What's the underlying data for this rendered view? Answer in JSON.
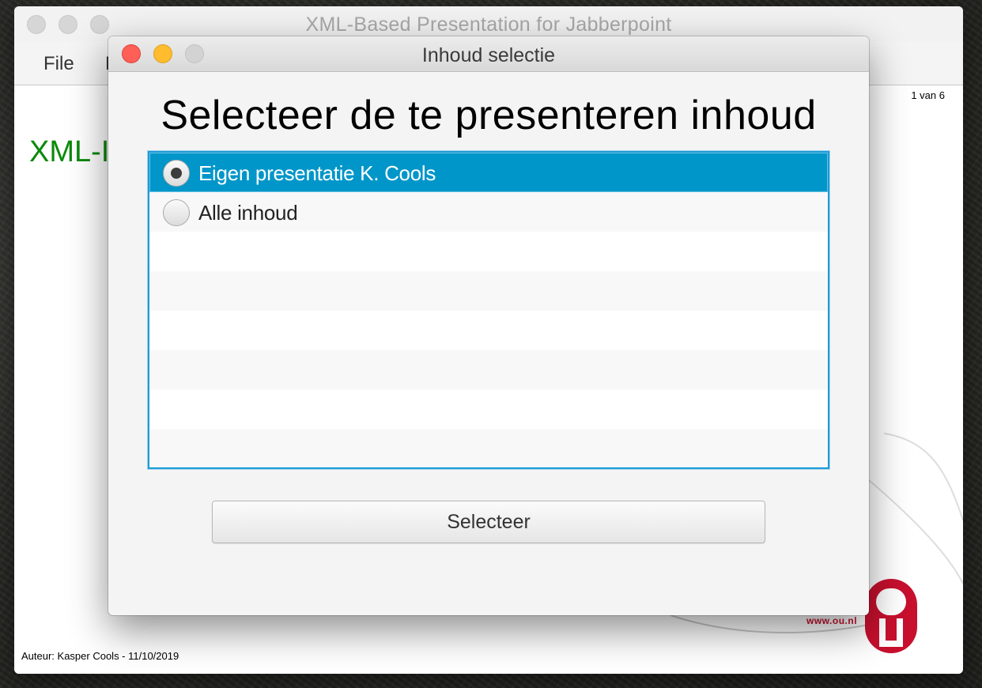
{
  "main_window": {
    "title": "XML-Based Presentation for Jabberpoint",
    "menu": [
      "File",
      "N"
    ],
    "slide": {
      "counter": "1 van 6",
      "title": "XML-I",
      "author": "Auteur: Kasper Cools - 11/10/2019",
      "logo_url": "www.ou.nl"
    }
  },
  "dialog": {
    "title": "Inhoud selectie",
    "heading": "Selecteer de te presenteren inhoud",
    "options": [
      {
        "label": "Eigen presentatie K. Cools",
        "selected": true
      },
      {
        "label": "Alle inhoud",
        "selected": false
      }
    ],
    "button_label": "Selecteer"
  },
  "colors": {
    "selection": "#0096c9",
    "list_border": "#1e9ad6",
    "slide_title": "#0a8a0a",
    "ou_red": "#c8102e"
  }
}
